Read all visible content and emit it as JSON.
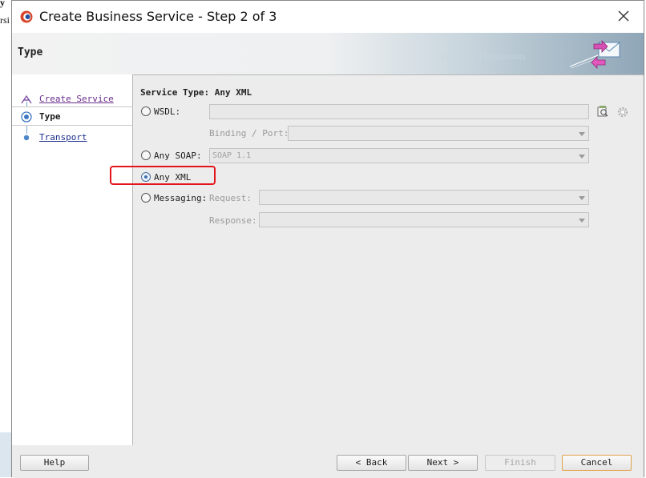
{
  "background": {
    "fragment_1": "y",
    "fragment_2": "rsi"
  },
  "window": {
    "title": "Create Business Service - Step 2 of 3",
    "close_icon": "close-icon"
  },
  "banner": {
    "page_title": "Type",
    "binary_text": "0101010101010101010101"
  },
  "nav": {
    "items": [
      {
        "label": "Create Service",
        "state": "visited"
      },
      {
        "label": "Type",
        "state": "active"
      },
      {
        "label": "Transport",
        "state": "pending"
      }
    ]
  },
  "form": {
    "section_title": "Service Type: Any XML",
    "wsdl": {
      "label": "WSDL:",
      "value": ""
    },
    "binding": {
      "label": "Binding / Port:",
      "value": ""
    },
    "any_soap": {
      "label": "Any SOAP:",
      "value": "SOAP 1.1"
    },
    "any_xml": {
      "label": "Any XML",
      "selected": true
    },
    "messaging": {
      "label": "Messaging:"
    },
    "request": {
      "label": "Request:",
      "value": ""
    },
    "response": {
      "label": "Response:",
      "value": ""
    }
  },
  "buttons": {
    "help": "Help",
    "back": "< Back",
    "next": "Next >",
    "finish": "Finish",
    "cancel": "Cancel"
  },
  "colors": {
    "highlight": "#e4141b",
    "link": "#1c2f8f",
    "visited_link": "#6a2c8c"
  }
}
